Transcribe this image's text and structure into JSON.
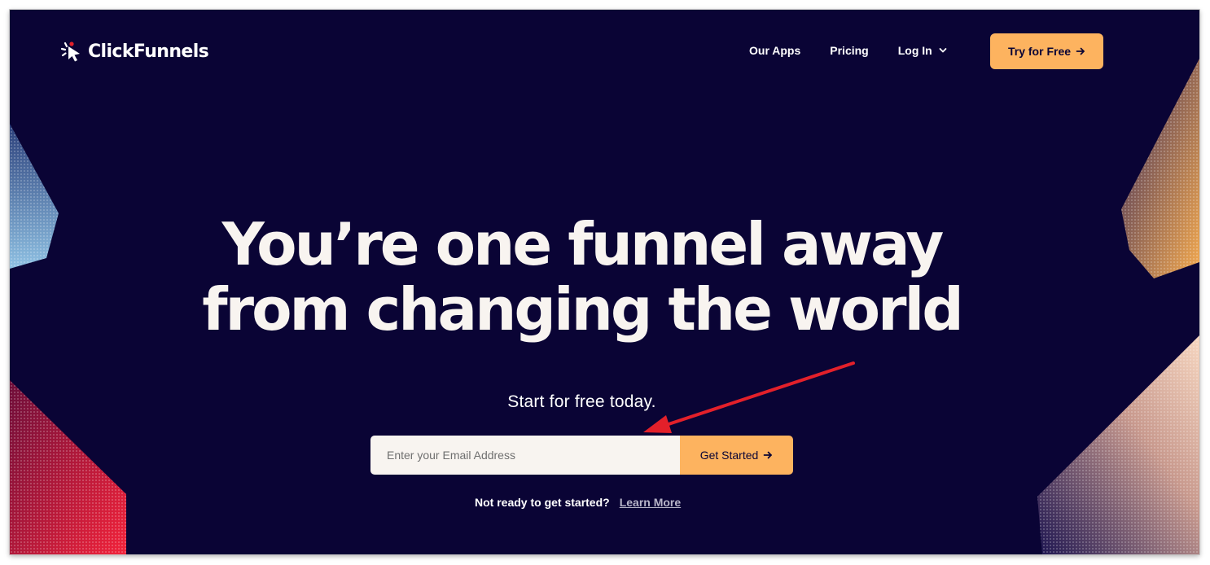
{
  "brand": {
    "name": "ClickFunnels",
    "logo_icon": "cursor-burst-icon"
  },
  "nav": {
    "links": [
      {
        "label": "Our Apps"
      },
      {
        "label": "Pricing"
      },
      {
        "label": "Log In"
      }
    ],
    "cta_label": "Try for Free"
  },
  "hero": {
    "title_line1": "You’re one funnel away",
    "title_line2": "from changing the world",
    "subtitle": "Start for free today."
  },
  "form": {
    "email_value": "",
    "email_placeholder": "Enter your Email Address",
    "submit_label": "Get Started"
  },
  "footer_note": {
    "text": "Not ready to get started?",
    "link_label": "Learn More"
  },
  "colors": {
    "background": "#0a0435",
    "accent": "#fdb35f",
    "text": "#f8f4f0",
    "annotation_arrow": "#e3202a"
  }
}
